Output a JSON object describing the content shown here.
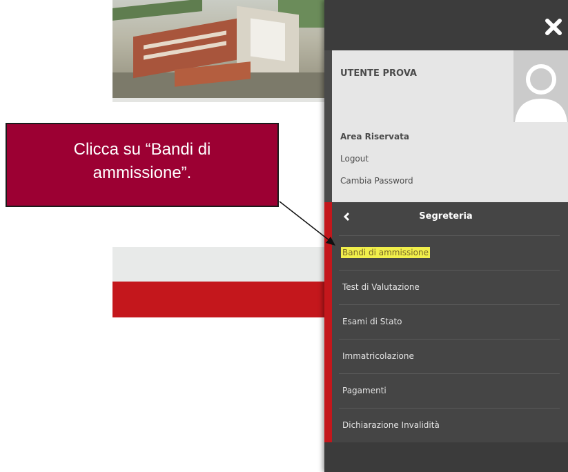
{
  "callout": {
    "line1": "Clicca su “Bandi di",
    "line2": "ammissione”."
  },
  "panel": {
    "close_icon": "close-icon",
    "user_name": "UTENTE PROVA",
    "section_label": "Area Riservata",
    "links": [
      "Logout",
      "Cambia Password"
    ],
    "avatar_icon": "avatar-silhouette-icon"
  },
  "menu": {
    "title": "Segreteria",
    "back_icon": "chevron-left-icon",
    "items": [
      "Bandi di ammissione",
      "Test di Valutazione",
      "Esami di Stato",
      "Immatricolazione",
      "Pagamenti",
      "Dichiarazione Invalidità"
    ],
    "active_index": 0
  },
  "colors": {
    "callout_bg": "#9c0033",
    "panel_bg": "#4a4a4a",
    "accent_red": "#c4171c",
    "highlight": "#f1ef4b"
  }
}
